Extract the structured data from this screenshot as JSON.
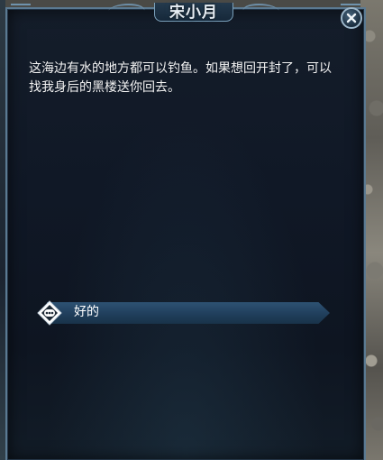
{
  "npc": {
    "name": "宋小月"
  },
  "dialog": {
    "text": "这海边有水的地方都可以钓鱼。如果想回开封了，可以找我身后的黑楼送你回去。"
  },
  "options": [
    {
      "label": "好的",
      "icon": "speech-bubble-icon"
    }
  ],
  "close": {
    "icon": "close-icon"
  },
  "colors": {
    "panel": "#101826",
    "border": "#5b7a92",
    "option_ribbon": "#1f3d5a",
    "text": "#f2f2f2"
  }
}
